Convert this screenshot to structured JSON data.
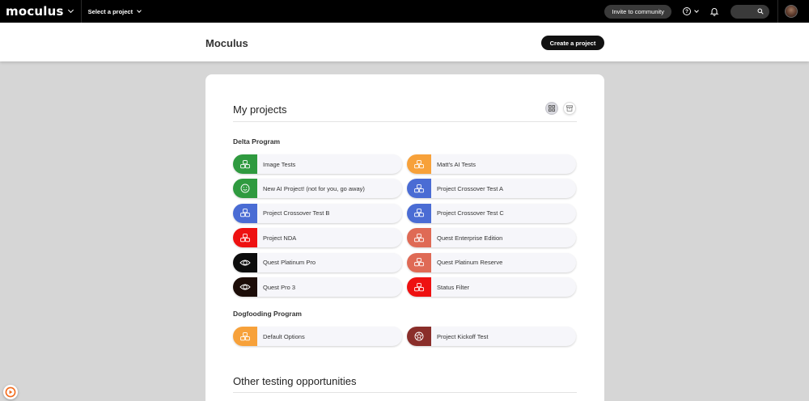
{
  "topbar": {
    "logo": "moculus",
    "project_select_label": "Select a project",
    "invite_label": "Invite to community",
    "help_glyph": "?"
  },
  "header": {
    "title": "Moculus",
    "create_button_label": "Create a project"
  },
  "projects": {
    "title": "My projects",
    "sections": [
      {
        "name": "Delta Program",
        "items": [
          {
            "label": "Image Tests",
            "color": "#2f9a3f",
            "icon": "cubes-icon"
          },
          {
            "label": "Matt's AI Tests",
            "color": "#f7a13a",
            "icon": "cubes-icon"
          },
          {
            "label": "New AI Project! (not for you, go away)",
            "color": "#2f9a3f",
            "icon": "smiley-icon"
          },
          {
            "label": "Project Crossover Test A",
            "color": "#4a6cd4",
            "icon": "cubes-icon"
          },
          {
            "label": "Project Crossover Test B",
            "color": "#4a6cd4",
            "icon": "cubes-icon"
          },
          {
            "label": "Project Crossover Test C",
            "color": "#4a6cd4",
            "icon": "cubes-icon"
          },
          {
            "label": "Project NDA",
            "color": "#ee1111",
            "icon": "cubes-icon"
          },
          {
            "label": "Quest Enterprise Edition",
            "color": "#df6a55",
            "icon": "cubes-icon"
          },
          {
            "label": "Quest Platinum Pro",
            "color": "#0d0d0d",
            "icon": "eye-icon"
          },
          {
            "label": "Quest Platinum Reserve",
            "color": "#df6a55",
            "icon": "cubes-icon"
          },
          {
            "label": "Quest Pro 3",
            "color": "#1c0d08",
            "icon": "eye-icon"
          },
          {
            "label": "Status Filter",
            "color": "#ee1111",
            "icon": "cubes-icon"
          }
        ]
      },
      {
        "name": "Dogfooding Program",
        "items": [
          {
            "label": "Default Options",
            "color": "#f7a13a",
            "icon": "cubes-icon"
          },
          {
            "label": "Project Kickoff Test",
            "color": "#8a2e2a",
            "icon": "ball-icon"
          }
        ]
      }
    ],
    "other_title": "Other testing opportunities"
  }
}
